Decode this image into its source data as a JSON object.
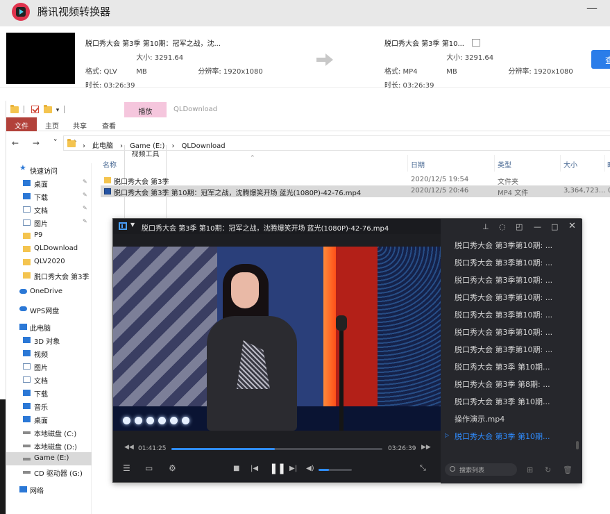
{
  "converter": {
    "app_title": "腾讯视频转换器",
    "minimize": "—",
    "source": {
      "name": "脱口秀大会 第3季 第10期：冠军之战，沈...",
      "format_label": "格式: QLV",
      "size_label": "大小: 3291.64 MB",
      "resolution_label": "分辨率: 1920x1080",
      "duration_label": "时长: 03:26:39"
    },
    "target": {
      "name": "脱口秀大会 第3季 第10...",
      "format_label": "格式: MP4",
      "size_label": "大小: 3291.64 MB",
      "resolution_label": "分辨率: 1920x1080",
      "duration_label": "时长: 03:26:39"
    },
    "convert_button": "查"
  },
  "explorer": {
    "context_tab": "播放",
    "window_title": "QLDownload",
    "ribbon_tabs": [
      "文件",
      "主页",
      "共享",
      "查看",
      "视频工具"
    ],
    "nav_arrows": "← → ˅ ↑",
    "address": [
      "此电脑",
      "Game (E:)",
      "QLDownload"
    ],
    "nav": [
      {
        "label": "快速访问",
        "icon": "star-icon"
      },
      {
        "label": "桌面",
        "icon": "desktop-icon",
        "pin": true
      },
      {
        "label": "下载",
        "icon": "download-icon",
        "pin": true
      },
      {
        "label": "文档",
        "icon": "document-icon",
        "pin": true
      },
      {
        "label": "图片",
        "icon": "pictures-icon",
        "pin": true
      },
      {
        "label": "P9",
        "icon": "folder-icon"
      },
      {
        "label": "QLDownload",
        "icon": "folder-icon"
      },
      {
        "label": "QLV2020",
        "icon": "folder-icon"
      },
      {
        "label": "脱口秀大会 第3季",
        "icon": "folder-icon"
      },
      {
        "label": "OneDrive",
        "icon": "cloud-icon"
      },
      {
        "label": "WPS网盘",
        "icon": "cloud-icon"
      },
      {
        "label": "此电脑",
        "icon": "computer-icon"
      },
      {
        "label": "3D 对象",
        "icon": "3d-icon"
      },
      {
        "label": "视频",
        "icon": "video-icon"
      },
      {
        "label": "图片",
        "icon": "pictures-icon"
      },
      {
        "label": "文档",
        "icon": "document-icon"
      },
      {
        "label": "下载",
        "icon": "download-icon"
      },
      {
        "label": "音乐",
        "icon": "music-icon"
      },
      {
        "label": "桌面",
        "icon": "desktop-icon"
      },
      {
        "label": "本地磁盘 (C:)",
        "icon": "drive-icon"
      },
      {
        "label": "本地磁盘 (D:)",
        "icon": "drive-icon"
      },
      {
        "label": "Game (E:)",
        "icon": "drive-icon",
        "selected": true
      },
      {
        "label": "CD 驱动器 (G:)",
        "icon": "cd-icon"
      },
      {
        "label": "网络",
        "icon": "network-icon"
      }
    ],
    "columns": [
      "名称",
      "日期",
      "类型",
      "大小",
      "时"
    ],
    "files": [
      {
        "name": "脱口秀大会 第3季",
        "date": "2020/12/5 19:54",
        "type": "文件夹",
        "size": "",
        "extra": "",
        "kind": "folder"
      },
      {
        "name": "脱口秀大会 第3季 第10期：冠军之战，沈腾爆笑开场 蓝光(1080P)-42-76.mp4",
        "date": "2020/12/5 20:46",
        "type": "MP4 文件",
        "size": "3,364,723...",
        "extra": "0",
        "kind": "mp4",
        "selected": true
      }
    ]
  },
  "player": {
    "title": "脱口秀大会 第3季 第10期：冠军之战，沈腾爆笑开场 蓝光(1080P)-42-76.mp4",
    "elapsed": "01:41:25",
    "total": "03:26:39",
    "progress": 0.49,
    "volume": 0.32,
    "playlist": [
      "脱口秀大会 第3季第10期: ...",
      "脱口秀大会 第3季第10期: ...",
      "脱口秀大会 第3季第10期: ...",
      "脱口秀大会 第3季第10期: ...",
      "脱口秀大会 第3季第10期: ...",
      "脱口秀大会 第3季第10期: ...",
      "脱口秀大会 第3季第10期: ...",
      "脱口秀大会 第3季 第10期...",
      "脱口秀大会 第3季 第8期: ...",
      "脱口秀大会 第3季 第10期...",
      "操作演示.mp4",
      "脱口秀大会 第3季 第10期..."
    ],
    "active_index": 11,
    "search_placeholder": "搜索列表",
    "accent": "#2f8cff"
  }
}
